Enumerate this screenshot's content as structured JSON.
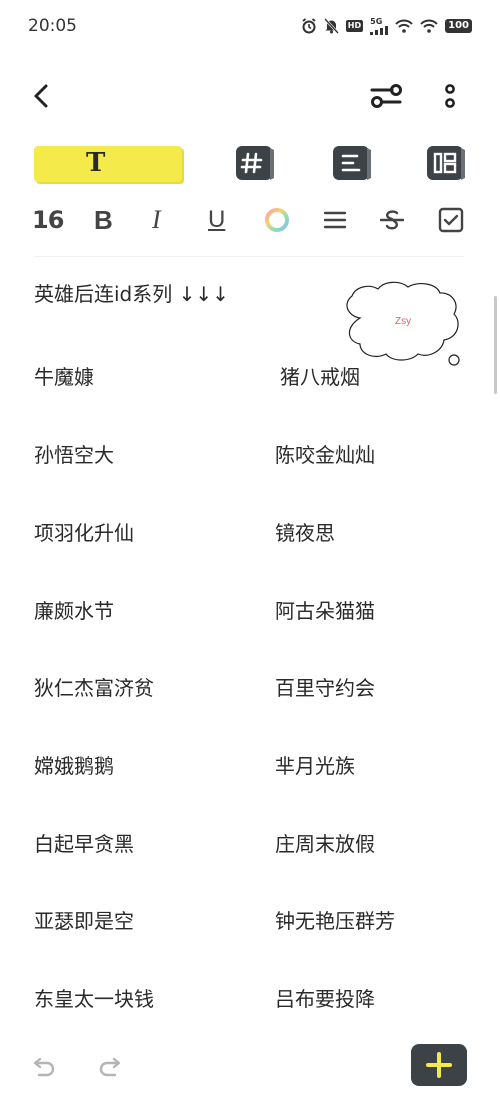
{
  "status_bar": {
    "time": "20:05",
    "network": "5G",
    "hd": "HD",
    "battery": "100"
  },
  "toolbar": {
    "text_tool": "T",
    "font_size": "16",
    "bold": "B",
    "italic": "I",
    "underline": "U"
  },
  "note": {
    "heading": "英雄后连id系列 ↓↓↓",
    "bubble_text": "Zsy",
    "rows": [
      {
        "left": "牛魔嫝",
        "right": "猪八戒烟"
      },
      {
        "left": "孙悟空大",
        "right": "陈咬金灿灿"
      },
      {
        "left": "项羽化升仙",
        "right": "镜夜思"
      },
      {
        "left": "廉颇水节",
        "right": "阿古朵猫猫"
      },
      {
        "left": "狄仁杰富济贫",
        "right": "百里守约会"
      },
      {
        "left": "嫦娥鹅鹅",
        "right": "芈月光族"
      },
      {
        "left": "白起早贪黑",
        "right": "庄周末放假"
      },
      {
        "left": "亚瑟即是空",
        "right": "钟无艳压群芳"
      },
      {
        "left": "东皇太一块钱",
        "right": "吕布要投降"
      }
    ]
  },
  "colors": {
    "highlight": "#f4ea4a",
    "dark": "#3d4247",
    "add_icon": "#f4ea4a"
  }
}
